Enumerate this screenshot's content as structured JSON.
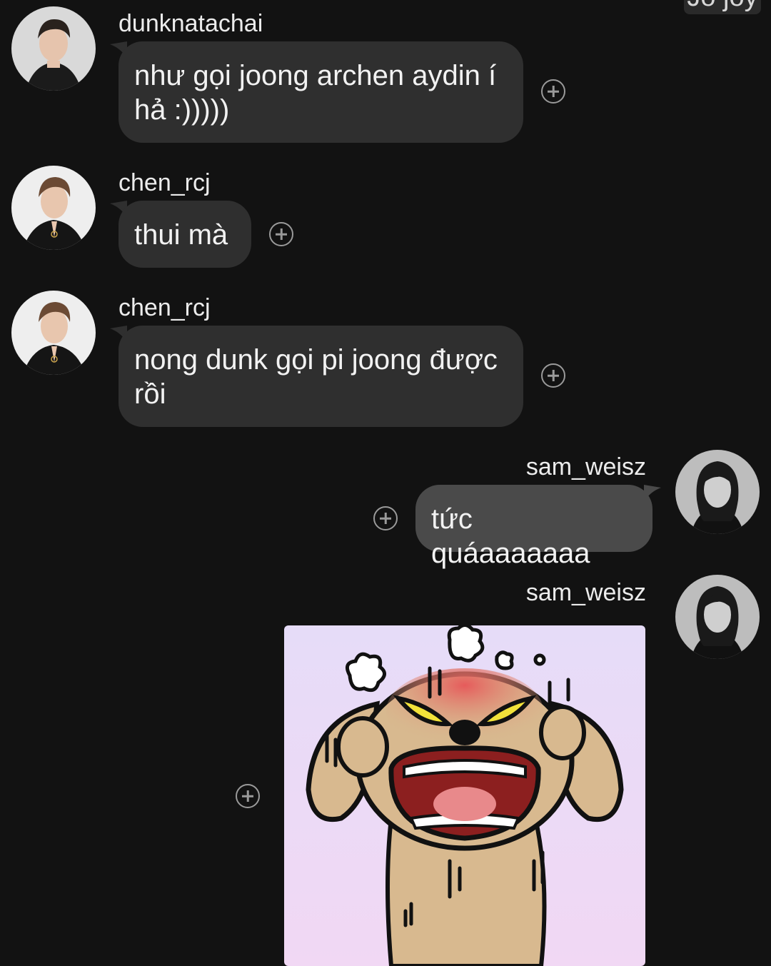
{
  "top_chip": {
    "text": "Jo joy"
  },
  "messages": [
    {
      "username": "dunknatachai",
      "text": "như gọi joong archen aydin í hả :)))))",
      "side": "left"
    },
    {
      "username": "chen_rcj",
      "text": "thui mà",
      "side": "left"
    },
    {
      "username": "chen_rcj",
      "text": "nong dunk gọi pi joong được rồi",
      "side": "left"
    },
    {
      "username": "sam_weisz",
      "text": "tức quáaaaaaaa",
      "side": "right"
    },
    {
      "username": "sam_weisz",
      "sticker": "angry-cartoon-sticker",
      "side": "right"
    }
  ],
  "icons": {
    "react": "add-reaction-icon",
    "avatar": "profile-photo"
  },
  "colors": {
    "background": "#121212",
    "bubble_other": "#2f2f2f",
    "bubble_mine": "#4a4a4a",
    "sticker_bg": "#eadcf7"
  }
}
